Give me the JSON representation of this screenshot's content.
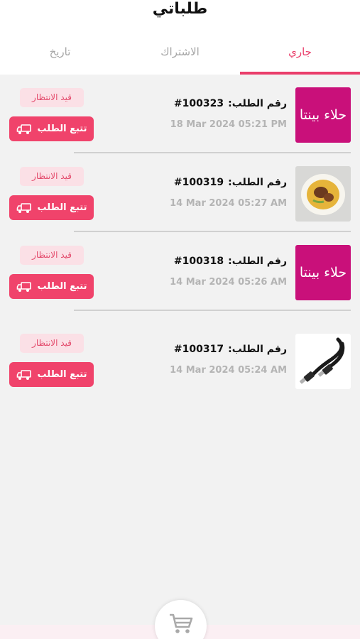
{
  "header": {
    "title": "طلباتي",
    "tabs": [
      {
        "label": "جاري",
        "active": true
      },
      {
        "label": "الاشتراك",
        "active": false
      },
      {
        "label": "تاريخ",
        "active": false
      }
    ]
  },
  "orders": [
    {
      "order_label": "رقم الطلب:",
      "order_number": "#100323",
      "date": "18 Mar 2024  05:21 PM",
      "status": "قيد الانتظار",
      "track_label": "تتبع الطلب",
      "thumb_text": "حلاء بينتا"
    },
    {
      "order_label": "رقم الطلب:",
      "order_number": "#100319",
      "date": "14 Mar 2024  05:27 AM",
      "status": "قيد الانتظار",
      "track_label": "تتبع الطلب"
    },
    {
      "order_label": "رقم الطلب:",
      "order_number": "#100318",
      "date": "14 Mar 2024  05:26 AM",
      "status": "قيد الانتظار",
      "track_label": "تتبع الطلب",
      "thumb_text": "حلاء بينتا"
    },
    {
      "order_label": "رقم الطلب:",
      "order_number": "#100317",
      "date": "14 Mar 2024  05:24 AM",
      "status": "قيد الانتظار",
      "track_label": "تتبع الطلب"
    }
  ],
  "colors": {
    "accent": "#ea3e6b",
    "brand_thumb": "#c9107a",
    "badge_bg": "#fbe0e6"
  },
  "icons": {
    "track": "delivery-truck-icon",
    "cart": "shopping-cart-icon"
  }
}
